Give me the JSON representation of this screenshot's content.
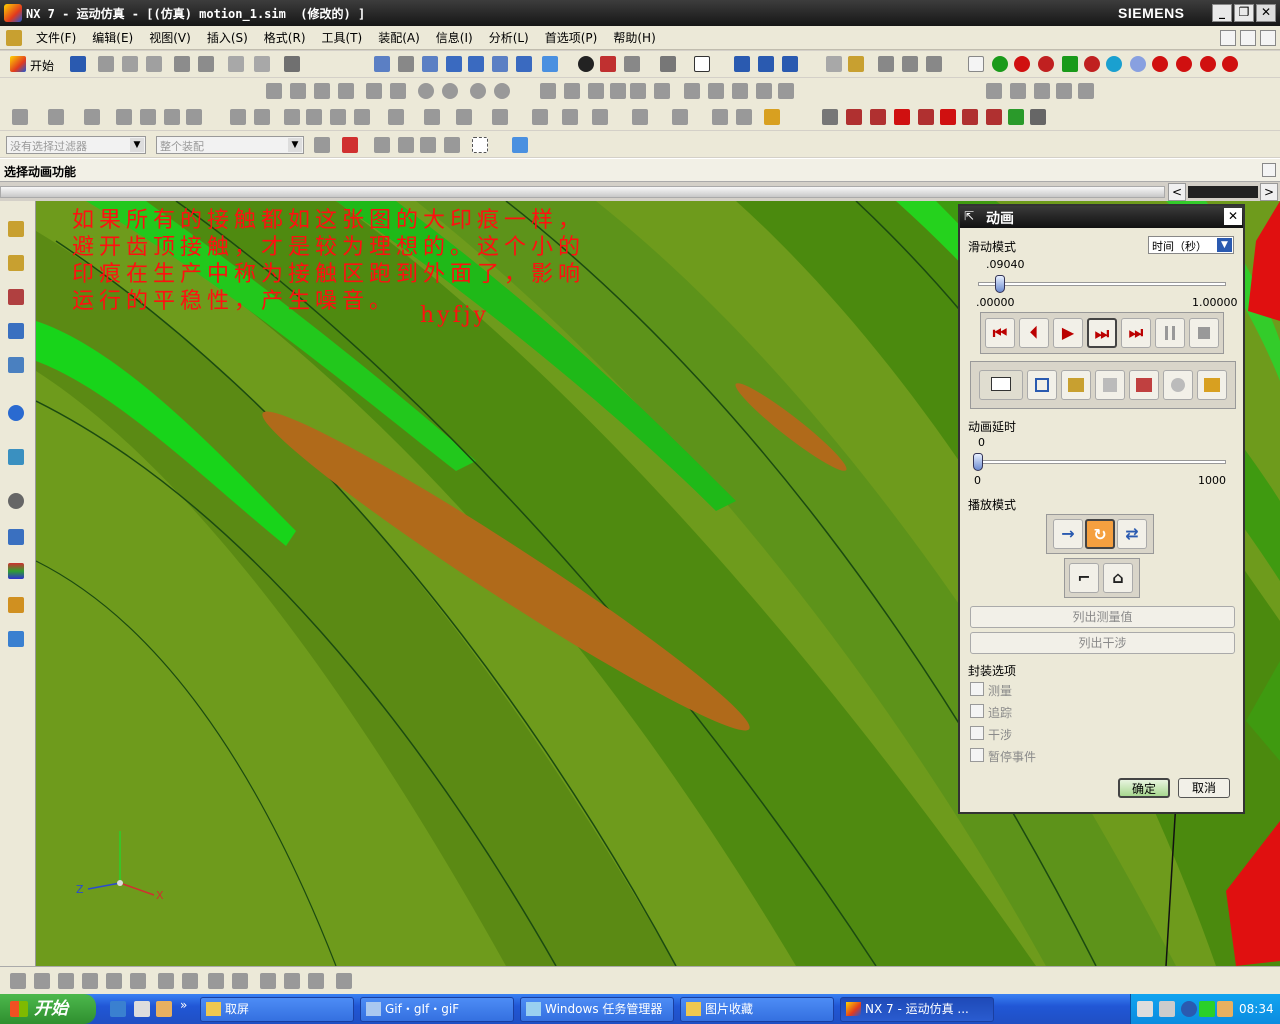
{
  "titlebar": {
    "title": "NX 7 - 运动仿真 - [(仿真) motion_1.sim  (修改的) ]",
    "brand": "SIEMENS",
    "minimize_glyph": "_",
    "restore_glyph": "❐",
    "close_glyph": "✕"
  },
  "menu": [
    "文件(F)",
    "编辑(E)",
    "视图(V)",
    "插入(S)",
    "格式(R)",
    "工具(T)",
    "装配(A)",
    "信息(I)",
    "分析(L)",
    "首选项(P)",
    "帮助(H)"
  ],
  "toolbar": {
    "start_label": "开始",
    "filter_placeholder": "没有选择过滤器",
    "scope_placeholder": "整个装配"
  },
  "status": {
    "text": "选择动画功能"
  },
  "annotation": {
    "lines": [
      "如果所有的接触都如这张图的大印痕一样，",
      "避开齿顶接触，才是较为理想的。这个小的",
      "印痕在生产中称为接触区跑到外面了，影响",
      "运行的平稳性，产生噪音。"
    ],
    "signature": "hyfjy"
  },
  "triad": {
    "axis_z": "Z",
    "axis_x": "X"
  },
  "dialog": {
    "title": "动画",
    "close_glyph": "✕",
    "slider_mode_label": "滑动模式",
    "slider_mode_value": "时间（秒）",
    "time_value": ".09040",
    "time_min": ".00000",
    "time_max": "1.00000",
    "time_position": 0.0904,
    "playback_buttons": [
      "⏮",
      "⏴",
      "▶",
      "⏭",
      "⏭"
    ],
    "anim_delay_label": "动画延时",
    "anim_delay_value": "0",
    "delay_min": "0",
    "delay_max": "1000",
    "delay_position": 0.0,
    "play_mode_label": "播放模式",
    "list_measure": "列出测量值",
    "list_interference": "列出干涉",
    "package_options": "封装选项",
    "checkboxes": [
      "测量",
      "追踪",
      "干涉",
      "暂停事件"
    ],
    "ok": "确定",
    "cancel": "取消"
  },
  "taskbar": {
    "start": "开始",
    "tasks": [
      "取屏",
      "Gif・gIf・giF",
      "Windows 任务管理器",
      "图片收藏",
      "NX 7 - 运动仿真 ..."
    ],
    "clock": "08:34"
  },
  "colors": {
    "viewport_base": "#6e9b1c",
    "bright_green": "#18d41a",
    "contact_patch": "#b06a1a",
    "annotation_red": "#ff1010"
  }
}
